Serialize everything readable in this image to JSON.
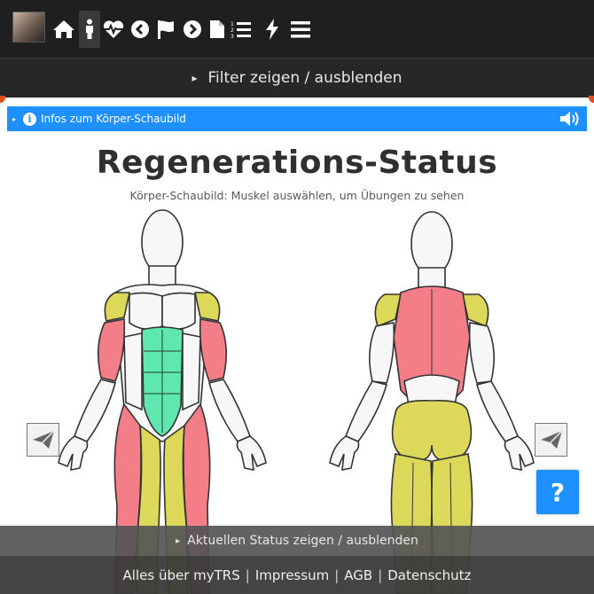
{
  "nav": {
    "icons": [
      "home-icon",
      "person-icon",
      "heartbeat-icon",
      "arrow-left-circle-icon",
      "flag-icon",
      "arrow-right-circle-icon",
      "document-icon",
      "numbered-list-icon",
      "lightning-icon",
      "menu-icon"
    ]
  },
  "filter_toggle": {
    "arrow": "▸",
    "label": "Filter zeigen / ausblenden"
  },
  "info_bar": {
    "arrow": "▸",
    "icon": "i",
    "label": "Infos zum Körper-Schaubild"
  },
  "heading": {
    "title": "Regenerations-Status",
    "subtitle": "Körper-Schaubild: Muskel auswählen, um Übungen zu sehen"
  },
  "help": {
    "label": "?"
  },
  "status_toggle": {
    "arrow": "▸",
    "label": "Aktuellen Status zeigen / ausblenden"
  },
  "footer": {
    "links": [
      "Alles über myTRS",
      "Impressum",
      "AGB",
      "Datenschutz"
    ],
    "separator": "|"
  },
  "colors": {
    "recovered": "#5ee8b0",
    "partly": "#dcd95a",
    "fatigued": "#f47e88",
    "accent": "#1e90ff",
    "topbar": "#1f1f1f"
  }
}
